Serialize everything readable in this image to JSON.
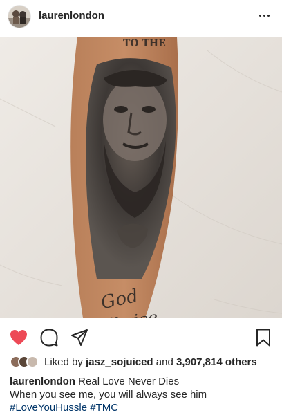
{
  "post": {
    "username": "laurenlondon",
    "tattoo_lines": [
      "God",
      "will rise"
    ],
    "top_text_fragment": "TO THE"
  },
  "actions": {
    "liked": true,
    "like_color": "#ed4956",
    "icons": [
      "heart-icon",
      "comment-icon",
      "share-icon",
      "bookmark-icon"
    ]
  },
  "likes": {
    "prefix": "Liked by",
    "liker": "jasz_sojuiced",
    "conjunction": "and",
    "others": "3,907,814 others"
  },
  "caption": {
    "username": "laurenlondon",
    "line1": "Real Love Never Dies",
    "line2": "When you see me, you will always see him",
    "hashtags": [
      "#LoveYouHussle",
      "#TMC"
    ]
  },
  "colors": {
    "text": "#262626",
    "hashtag": "#003569",
    "background": "#ffffff"
  }
}
